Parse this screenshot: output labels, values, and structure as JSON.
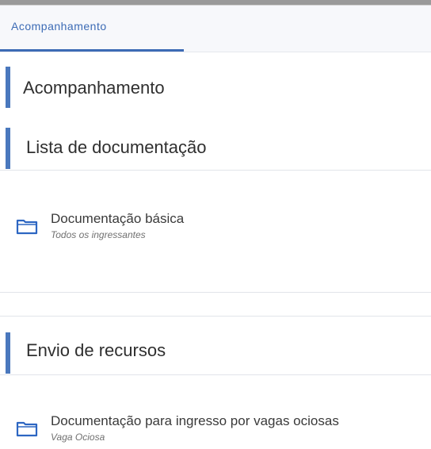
{
  "tabs": [
    {
      "label": "Acompanhamento",
      "active": true
    }
  ],
  "colors": {
    "accent": "#3c6bb5",
    "section_bar": "#4a78bd",
    "folder_icon": "#2d66c2"
  },
  "sections": [
    {
      "title": "Acompanhamento"
    },
    {
      "title": "Lista de documentação"
    },
    {
      "title": "Envio de recursos"
    }
  ],
  "documents": [
    {
      "title": "Documentação básica",
      "subtitle": "Todos os ingressantes",
      "icon": "folder-icon"
    },
    {
      "title": "Documentação para ingresso por vagas ociosas",
      "subtitle": "Vaga Ociosa",
      "icon": "folder-icon"
    }
  ]
}
